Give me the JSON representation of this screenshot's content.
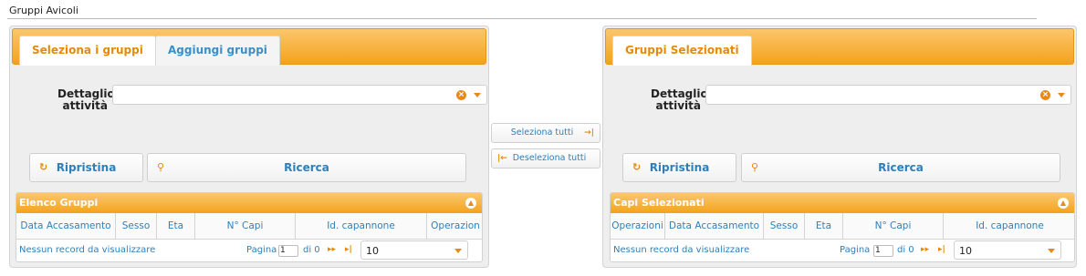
{
  "page": {
    "title": "Gruppi Avicoli"
  },
  "left": {
    "tabs": [
      "Seleziona i gruppi",
      "Aggiungi gruppi"
    ],
    "filter_label_line1": "Dettaglio",
    "filter_label_line2": "attività",
    "filter_value": "",
    "reset_label": "Ripristina",
    "search_label": "Ricerca",
    "grid": {
      "title": "Elenco Gruppi",
      "columns": [
        "Data Accasamento",
        "Sesso",
        "Eta",
        "N° Capi",
        "Id. capannone",
        "Operazion"
      ],
      "empty_message": "Nessun record da visualizzare",
      "page_label": "Pagina",
      "page_value": "1",
      "of_label": "di 0",
      "page_size": "10"
    }
  },
  "middle": {
    "select_all": "Seleziona tutti",
    "deselect_all": "Deseleziona tutti"
  },
  "right": {
    "tabs": [
      "Gruppi Selezionati"
    ],
    "filter_label_line1": "Dettaglio",
    "filter_label_line2": "attività",
    "filter_value": "",
    "reset_label": "Ripristina",
    "search_label": "Ricerca",
    "grid": {
      "title": "Capi Selezionati",
      "columns": [
        "Operazioni",
        "Data Accasamento",
        "Sesso",
        "Eta",
        "N° Capi",
        "Id. capannone"
      ],
      "empty_message": "Nessun record da visualizzare",
      "page_label": "Pagina",
      "page_value": "1",
      "of_label": "di 0",
      "page_size": "10"
    }
  },
  "icons": {
    "clear": "clear-icon",
    "dropdown": "chevron-down-icon",
    "reset": "refresh-icon",
    "search": "search-icon",
    "collapse": "chevron-up-icon",
    "select_all": "arrow-right-bar-icon",
    "deselect_all": "arrow-left-bar-icon"
  },
  "colors": {
    "accent": "#f4a21d",
    "link": "#2f7fb8",
    "active_tab_text": "#e48a08"
  }
}
